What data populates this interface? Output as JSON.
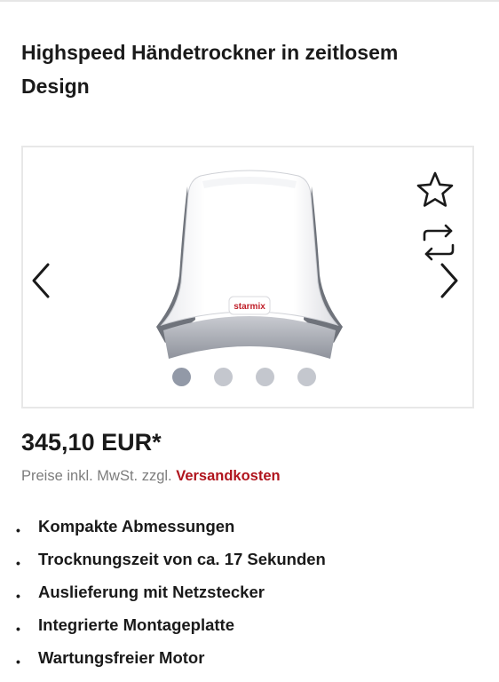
{
  "product": {
    "title": "Highspeed Händetrockner in zeitlosem Design",
    "brand_logo_text": "starmix",
    "price": "345,10 EUR*",
    "tax_note_prefix": "Preise inkl. MwSt. zzgl.",
    "shipping_link_label": "Versandkosten",
    "accent_color": "#b0141d"
  },
  "gallery": {
    "image_count": 4,
    "active_index": 0,
    "icons": [
      "chevron-left-icon",
      "chevron-right-icon",
      "star-outline-icon",
      "compare-arrows-icon"
    ]
  },
  "features": [
    "Kompakte Abmessungen",
    "Trocknungszeit von ca. 17 Sekunden",
    "Auslieferung mit Netzstecker",
    "Integrierte Montageplatte",
    "Wartungsfreier Motor"
  ]
}
